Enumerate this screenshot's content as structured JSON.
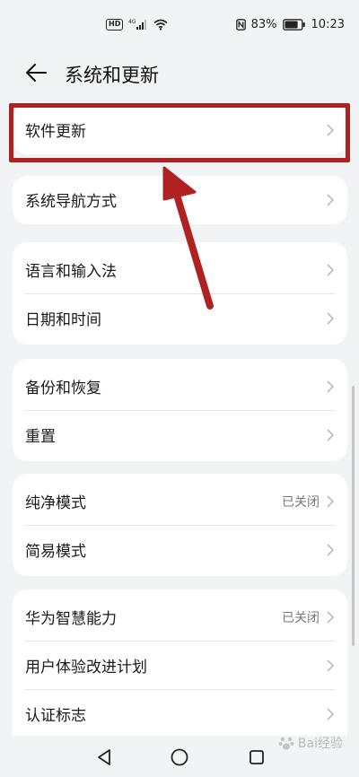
{
  "status_bar": {
    "hd_label": "HD",
    "signal_label": "4G",
    "battery_percent": "83%",
    "time": "10:23",
    "battery_level": 0.83
  },
  "header": {
    "title": "系统和更新"
  },
  "groups": [
    {
      "items": [
        {
          "label": "软件更新",
          "value": ""
        }
      ]
    },
    {
      "items": [
        {
          "label": "系统导航方式",
          "value": ""
        }
      ]
    },
    {
      "items": [
        {
          "label": "语言和输入法",
          "value": ""
        },
        {
          "label": "日期和时间",
          "value": ""
        }
      ]
    },
    {
      "items": [
        {
          "label": "备份和恢复",
          "value": ""
        },
        {
          "label": "重置",
          "value": ""
        }
      ]
    },
    {
      "items": [
        {
          "label": "纯净模式",
          "value": "已关闭"
        },
        {
          "label": "简易模式",
          "value": ""
        }
      ]
    },
    {
      "items": [
        {
          "label": "华为智慧能力",
          "value": "已关闭"
        },
        {
          "label": "用户体验改进计划",
          "value": ""
        },
        {
          "label": "认证标志",
          "value": ""
        }
      ]
    }
  ],
  "watermark": {
    "text": "Bai经验"
  },
  "colors": {
    "highlight": "#b02222",
    "background": "#f1f3f5",
    "card": "#ffffff"
  }
}
